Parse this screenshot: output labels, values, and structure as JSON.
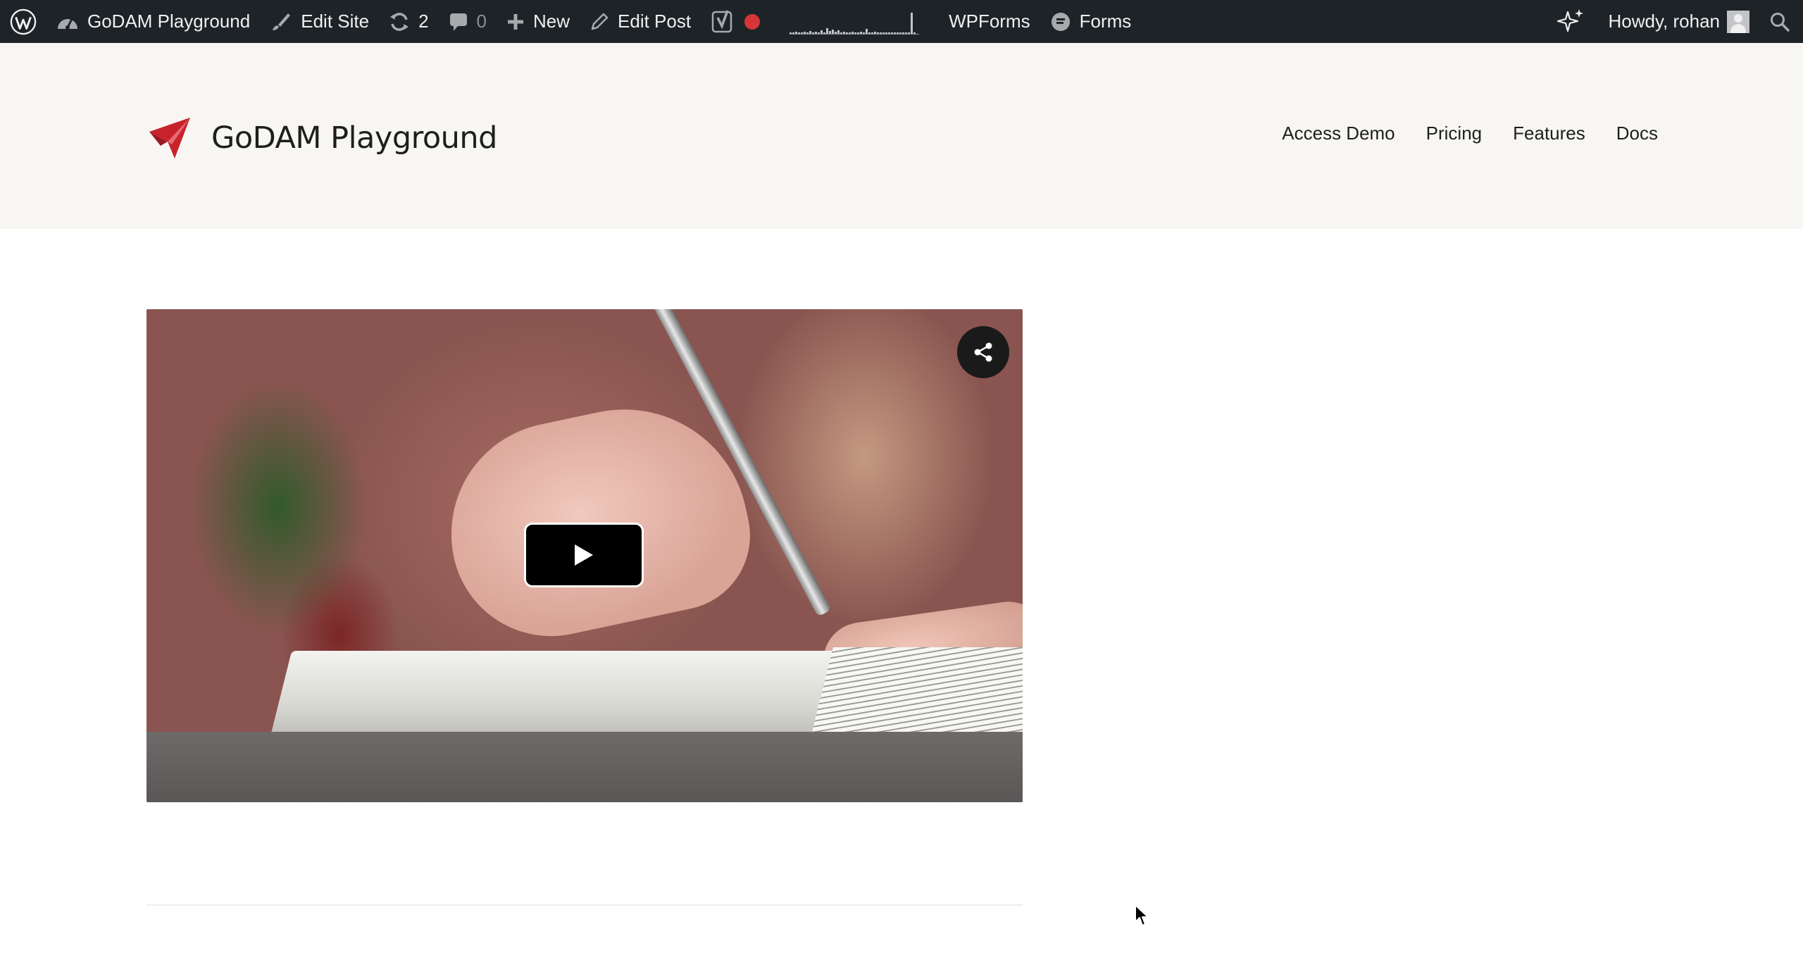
{
  "admin_bar": {
    "site_name": "GoDAM Playground",
    "edit_site": "Edit Site",
    "updates_count": "2",
    "comments_count": "0",
    "new_label": "New",
    "edit_post": "Edit Post",
    "wpforms": "WPForms",
    "forms": "Forms",
    "howdy": "Howdy, rohan"
  },
  "header": {
    "site_title": "GoDAM Playground",
    "nav": [
      "Access Demo",
      "Pricing",
      "Features",
      "Docs"
    ]
  },
  "colors": {
    "admin_bar_bg": "#1d2327",
    "header_bg": "#f7f6f2",
    "brand_red": "#c8232c",
    "record_dot": "#d63638"
  },
  "icons": {
    "wordpress": "wordpress-icon",
    "site": "dashboard-icon",
    "edit_site": "brush-icon",
    "updates": "refresh-icon",
    "comments": "comment-icon",
    "new": "plus-icon",
    "edit_post": "pencil-icon",
    "seo": "yoast-icon",
    "forms": "forms-icon",
    "ai": "sparkle-icon",
    "search": "search-icon",
    "play": "play-icon",
    "share": "share-icon"
  }
}
